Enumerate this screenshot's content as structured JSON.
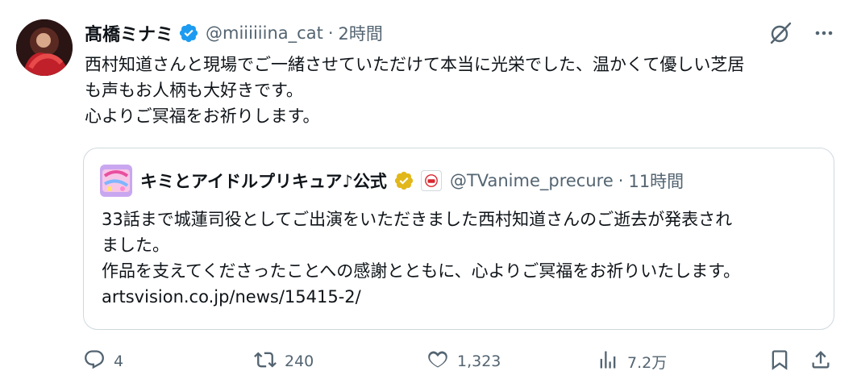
{
  "tweet": {
    "author": {
      "display_name": "髙橋ミナミ",
      "handle": "@miiiiiina_cat",
      "separator": "·",
      "time": "2時間"
    },
    "text_lines": [
      "西村知道さんと現場でご一緒させていただけて本当に光栄でした、温かくて優しい芝居",
      "も声もお人柄も大好きです。",
      "心よりご冥福をお祈りします。"
    ],
    "quote": {
      "display_name": "キミとアイドルプリキュア♪公式",
      "handle": "@TVanime_precure",
      "separator": "·",
      "time": "11時間",
      "text_lines": [
        "33話まで城蓮司役としてご出演をいただきました西村知道さんのご逝去が発表され",
        "ました。",
        "作品を支えてくださったことへの感謝とともに、心よりご冥福をお祈りいたします。",
        "artsvision.co.jp/news/15415-2/"
      ]
    },
    "actions": {
      "replies": "4",
      "reposts": "240",
      "likes": "1,323",
      "views": "7.2万"
    }
  },
  "colors": {
    "text": "#0f1419",
    "secondary": "#536471",
    "verified_blue": "#1d9bf0",
    "verified_gold": "#e2b719",
    "border": "#cfd9de"
  },
  "icons": {
    "verified": "verified-badge-icon",
    "grok": "grok-icon",
    "more": "more-icon",
    "reply": "reply-icon",
    "repost": "repost-icon",
    "like": "heart-icon",
    "views": "views-icon",
    "bookmark": "bookmark-icon",
    "share": "share-icon"
  }
}
